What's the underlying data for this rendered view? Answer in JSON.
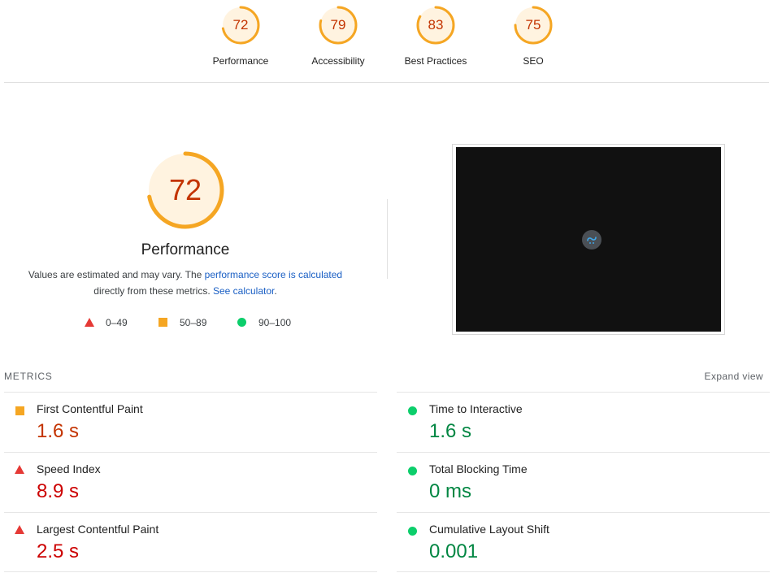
{
  "categories": [
    {
      "label": "Performance",
      "score": "72",
      "fraction": 0.72
    },
    {
      "label": "Accessibility",
      "score": "79",
      "fraction": 0.79
    },
    {
      "label": "Best Practices",
      "score": "83",
      "fraction": 0.83
    },
    {
      "label": "SEO",
      "score": "75",
      "fraction": 0.75
    }
  ],
  "performance": {
    "score": "72",
    "fraction": 0.72,
    "title": "Performance",
    "desc_part1": "Values are estimated and may vary. The ",
    "desc_link1": "performance score is calculated",
    "desc_part2": "directly from these metrics. ",
    "desc_link2": "See calculator",
    "desc_end": "."
  },
  "legend": [
    {
      "range": "0–49",
      "icon": "triangle-fail-icon"
    },
    {
      "range": "50–89",
      "icon": "square-average-icon"
    },
    {
      "range": "90–100",
      "icon": "circle-pass-icon"
    }
  ],
  "metrics": {
    "header": "METRICS",
    "expand_label": "Expand view",
    "left": [
      {
        "name": "First Contentful Paint",
        "value": "1.6 s",
        "status": "average"
      },
      {
        "name": "Speed Index",
        "value": "8.9 s",
        "status": "fail"
      },
      {
        "name": "Largest Contentful Paint",
        "value": "2.5 s",
        "status": "fail"
      }
    ],
    "right": [
      {
        "name": "Time to Interactive",
        "value": "1.6 s",
        "status": "pass"
      },
      {
        "name": "Total Blocking Time",
        "value": "0 ms",
        "status": "pass"
      },
      {
        "name": "Cumulative Layout Shift",
        "value": "0.001",
        "status": "pass"
      }
    ]
  },
  "colors": {
    "average": "#f5a623",
    "average_text": "#c33300",
    "fail": "#e53935",
    "pass": "#0cce6b",
    "gauge_bg": "#fff3e0",
    "link": "#1a5fc4"
  }
}
